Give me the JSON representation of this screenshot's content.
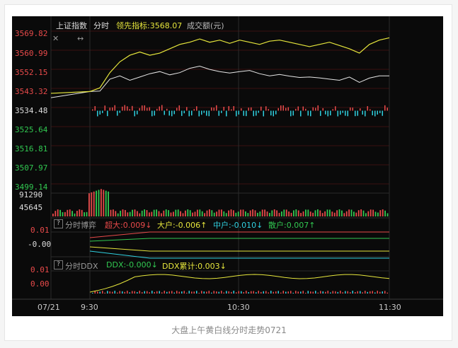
{
  "header": {
    "index_name": "上证指数",
    "mode": "分时",
    "leading_label": "领先指标:3568.07",
    "volume_label": "成交额(元)"
  },
  "price_axis": {
    "ticks": [
      "3569.82",
      "3560.99",
      "3552.15",
      "3543.32",
      "3534.48",
      "3525.64",
      "3516.81",
      "3507.97",
      "3499.14"
    ]
  },
  "volume_axis": {
    "ticks": [
      "91290",
      "45645"
    ]
  },
  "game_panel": {
    "question": "?",
    "title": "分时博弈",
    "super_large": "超大:0.009↓",
    "large": "大户:-0.006↑",
    "medium": "中户:-0.010↓",
    "retail": "散户:0.007↑",
    "ticks": [
      "0.01",
      "-0.00"
    ]
  },
  "ddx_panel": {
    "question": "?",
    "title": "分时DDX",
    "ddx": "DDX:-0.000↓",
    "ddx_cum": "DDX累计:0.003↓",
    "ticks": [
      "0.01",
      "0.00"
    ]
  },
  "time_axis": {
    "date": "07/21",
    "t1": "9:30",
    "t2": "10:30",
    "t3": "11:30"
  },
  "controls": {
    "close_symbol": "✕",
    "expand_symbol": "↔"
  },
  "caption": "大盘上午黄白线分时走势0721",
  "colors": {
    "up": "#e84a4a",
    "down": "#31c851",
    "white_line": "#e6e6e6",
    "yellow_line": "#e6e63c",
    "cyan": "#2fd0e0",
    "grid": "#3a1010"
  },
  "chart_data": {
    "type": "line",
    "x_range": [
      "9:30",
      "11:30"
    ],
    "ylim": [
      3499.14,
      3569.82
    ],
    "series": [
      {
        "name": "",
        "color": "yellow",
        "values": [
          3543.3,
          3545,
          3552,
          3557,
          3560,
          3561.5,
          3560,
          3561,
          3563,
          3565,
          3566,
          3567.5,
          3566,
          3567,
          3565.5,
          3567,
          3566,
          3565,
          3566.5,
          3567,
          3566,
          3565,
          3564,
          3565,
          3566,
          3564.5,
          3563,
          3561,
          3565,
          3567,
          3568.07
        ]
      },
      {
        "name": "",
        "color": "white",
        "values": [
          3543.3,
          3543.5,
          3549,
          3550.5,
          3548.5,
          3550,
          3551.5,
          3552.5,
          3551,
          3552,
          3554,
          3555,
          3553.5,
          3552.5,
          3551.8,
          3552.5,
          3553,
          3551.5,
          3550.5,
          3551.2,
          3550.4,
          3549.8,
          3550,
          3549.6,
          3549,
          3548.5,
          3550,
          3547.5,
          3549.5,
          3550.5,
          3550.5
        ]
      }
    ]
  }
}
